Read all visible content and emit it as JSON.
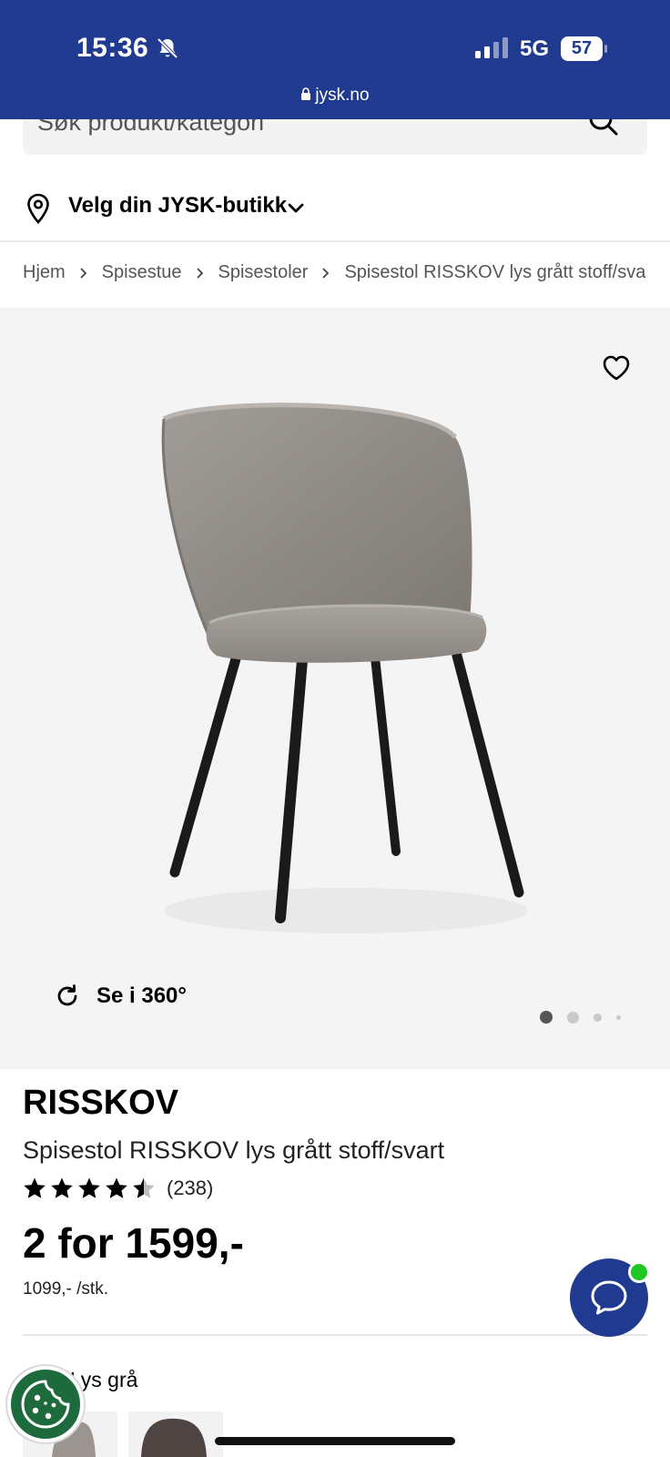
{
  "status_bar": {
    "time": "15:36",
    "network": "5G",
    "battery": "57",
    "url": "jysk.no"
  },
  "search": {
    "placeholder": "Søk produkt/kategori"
  },
  "store_picker": {
    "label": "Velg din JYSK-butikk"
  },
  "breadcrumb": [
    "Hjem",
    "Spisestue",
    "Spisestoler",
    "Spisestol RISSKOV lys grått stoff/sva"
  ],
  "gallery": {
    "rotate_label": "Se i 360°",
    "image_count": 4,
    "active_index": 0
  },
  "product": {
    "brand": "RISSKOV",
    "name": "Spisestol RISSKOV lys grått stoff/svart",
    "rating_stars": 4.5,
    "rating_count": "(238)",
    "price": "2 for 1599,-",
    "unit_price": "1099,- /stk."
  },
  "color": {
    "label": "e:",
    "value": "Lys grå"
  },
  "colors": {
    "header_bg": "#1f3a8f",
    "chat_button": "#1f3a8f",
    "chat_status": "#1ec723",
    "cookie_button": "#1d6b3c"
  },
  "icons": {
    "search": "search-icon",
    "location": "location-pin-icon",
    "favorite": "heart-icon",
    "rotate": "rotate-360-icon",
    "chat": "chat-bubble-icon",
    "cookie": "cookie-icon"
  }
}
